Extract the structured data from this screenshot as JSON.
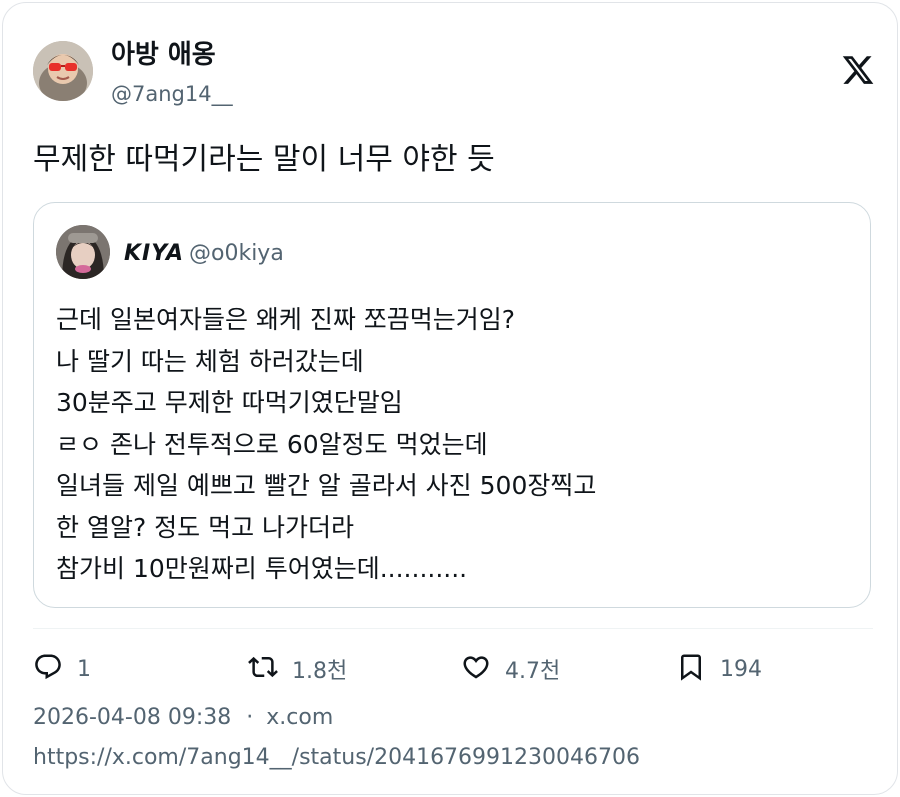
{
  "author": {
    "name": "아방 애옹",
    "handle": "@7ang14__"
  },
  "tweet": {
    "text": "무제한 따먹기라는 말이 너무 야한 듯"
  },
  "quote": {
    "name": "KIYA",
    "handle": "@o0kiya",
    "lines": [
      "근데 일본여자들은 왜케 진짜 쪼끔먹는거임?",
      "나 딸기 따는 체험 하러갔는데",
      "30분주고 무제한 따먹기였단말임",
      "ㄹㅇ 존나 전투적으로 60알정도 먹었는데",
      "일녀들 제일 예쁘고 빨간 알 골라서 사진 500장찍고",
      "한 열알? 정도 먹고 나가더라",
      "참가비 10만원짜리 투어였는데..........."
    ]
  },
  "actions": {
    "replies": "1",
    "reposts": "1.8천",
    "likes": "4.7천",
    "bookmarks": "194"
  },
  "meta": {
    "timestamp": "2026-04-08 09:38",
    "separator": "·",
    "source": "x.com",
    "url": "https://x.com/7ang14__/status/2041676991230046706"
  },
  "icons": {
    "reply": "reply-icon",
    "repost": "repost-icon",
    "like": "heart-icon",
    "bookmark": "bookmark-icon",
    "brand": "x-logo-icon"
  },
  "colors": {
    "text": "#0f1419",
    "secondary": "#536471",
    "border": "#cfd9de"
  }
}
